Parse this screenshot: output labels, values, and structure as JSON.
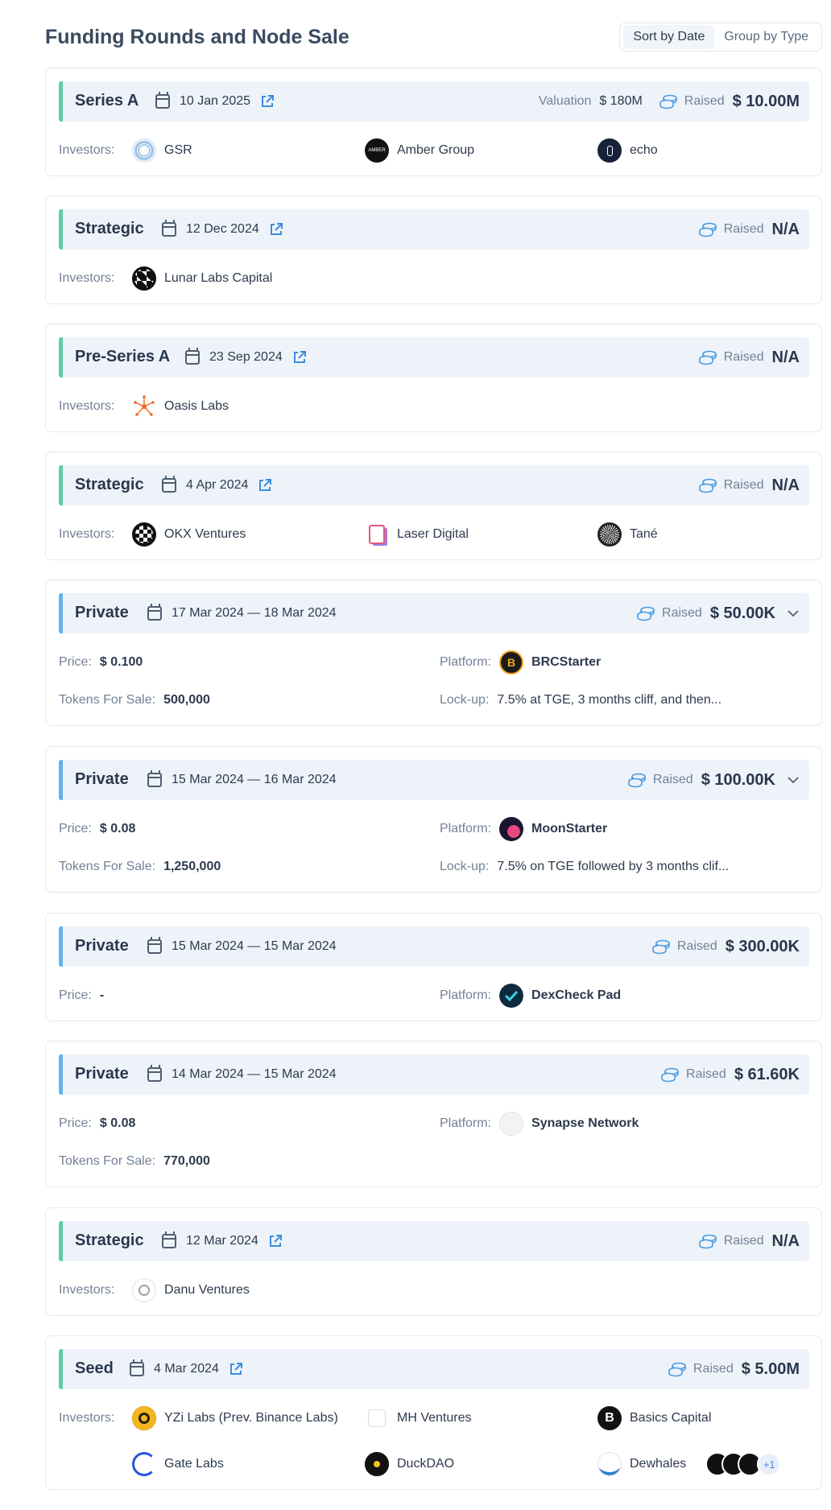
{
  "page": {
    "title": "Funding Rounds and Node Sale",
    "sort_by_date": "Sort by Date",
    "group_by_type": "Group by Type"
  },
  "labels": {
    "investors": "Investors:",
    "valuation": "Valuation",
    "raised": "Raised",
    "price": "Price:",
    "platform": "Platform:",
    "tokens_for_sale": "Tokens For Sale:",
    "lockup": "Lock-up:"
  },
  "rounds": [
    {
      "type": "Series A",
      "date": "10 Jan 2025",
      "valuation": "$ 180M",
      "raised": "$ 10.00M",
      "investors": [
        "GSR",
        "Amber Group",
        "echo"
      ]
    },
    {
      "type": "Strategic",
      "date": "12 Dec 2024",
      "raised": "N/A",
      "investors": [
        "Lunar Labs Capital"
      ]
    },
    {
      "type": "Pre-Series A",
      "date": "23 Sep 2024",
      "raised": "N/A",
      "investors": [
        "Oasis Labs"
      ]
    },
    {
      "type": "Strategic",
      "date": "4 Apr 2024",
      "raised": "N/A",
      "investors": [
        "OKX Ventures",
        "Laser Digital",
        "Tané"
      ]
    },
    {
      "type": "Private",
      "date": "17 Mar 2024 — 18 Mar 2024",
      "raised": "$ 50.00K",
      "price": "$ 0.100",
      "platform": "BRCStarter",
      "tokens_for_sale": "500,000",
      "lockup": "7.5% at TGE, 3 months cliff, and then..."
    },
    {
      "type": "Private",
      "date": "15 Mar 2024 — 16 Mar 2024",
      "raised": "$ 100.00K",
      "price": "$ 0.08",
      "platform": "MoonStarter",
      "tokens_for_sale": "1,250,000",
      "lockup": "7.5% on TGE followed by 3 months clif..."
    },
    {
      "type": "Private",
      "date": "15 Mar 2024 — 15 Mar 2024",
      "raised": "$ 300.00K",
      "price": "-",
      "platform": "DexCheck Pad"
    },
    {
      "type": "Private",
      "date": "14 Mar 2024 — 15 Mar 2024",
      "raised": "$ 61.60K",
      "price": "$ 0.08",
      "platform": "Synapse Network",
      "tokens_for_sale": "770,000"
    },
    {
      "type": "Strategic",
      "date": "12 Mar 2024",
      "raised": "N/A",
      "investors": [
        "Danu Ventures"
      ]
    },
    {
      "type": "Seed",
      "date": "4 Mar 2024",
      "raised": "$ 5.00M",
      "investors": [
        "YZi Labs (Prev. Binance Labs)",
        "MH Ventures",
        "Basics Capital",
        "Gate Labs",
        "DuckDAO",
        "Dewhales"
      ],
      "more_count": "+1"
    }
  ]
}
